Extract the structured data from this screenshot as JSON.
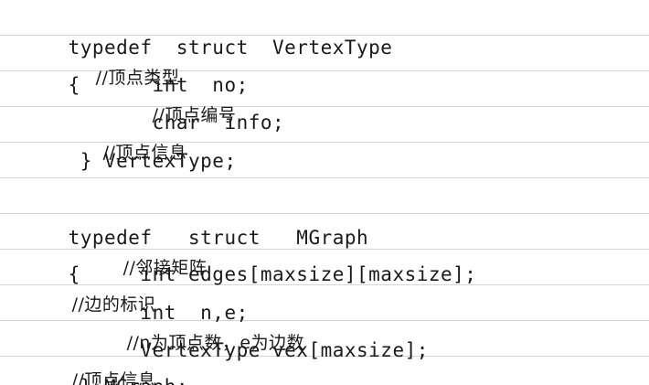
{
  "lines": [
    {
      "code": "typedef  struct  VertexType",
      "comment": "//顶点类型"
    },
    {
      "code": "{      int  no;",
      "comment": "//顶点编号"
    },
    {
      "code": "       char  info;",
      "comment": "//顶点信息"
    },
    {
      "code": " } VertexType;",
      "comment": ""
    },
    {
      "code": "typedef   struct   MGraph",
      "comment": "//邻接矩阵"
    },
    {
      "code": "{     int edges[maxsize][maxsize];",
      "comment": "//边的标识"
    },
    {
      "code": "      int  n,e;",
      "comment": "//n为顶点数，e为边数"
    },
    {
      "code": "      VertexType vex[maxsize];",
      "comment": "//顶点信息"
    },
    {
      "code": " } MGraph;",
      "comment": ""
    }
  ]
}
